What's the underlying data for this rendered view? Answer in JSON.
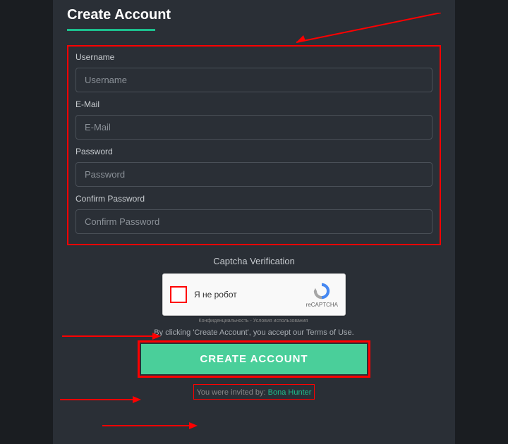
{
  "title": "Create Account",
  "fields": {
    "username": {
      "label": "Username",
      "placeholder": "Username"
    },
    "email": {
      "label": "E-Mail",
      "placeholder": "E-Mail"
    },
    "password": {
      "label": "Password",
      "placeholder": "Password"
    },
    "confirm": {
      "label": "Confirm Password",
      "placeholder": "Confirm Password"
    }
  },
  "captcha": {
    "title": "Captcha Verification",
    "checkbox_label": "Я не робот",
    "brand": "reCAPTCHA",
    "terms": "Конфиденциальность - Условия использования"
  },
  "tos": "By clicking 'Create Account', you accept our Terms of Use.",
  "submit_label": "CREATE ACCOUNT",
  "invited": {
    "prefix": "You were invited by: ",
    "name": "Bona Hunter"
  }
}
